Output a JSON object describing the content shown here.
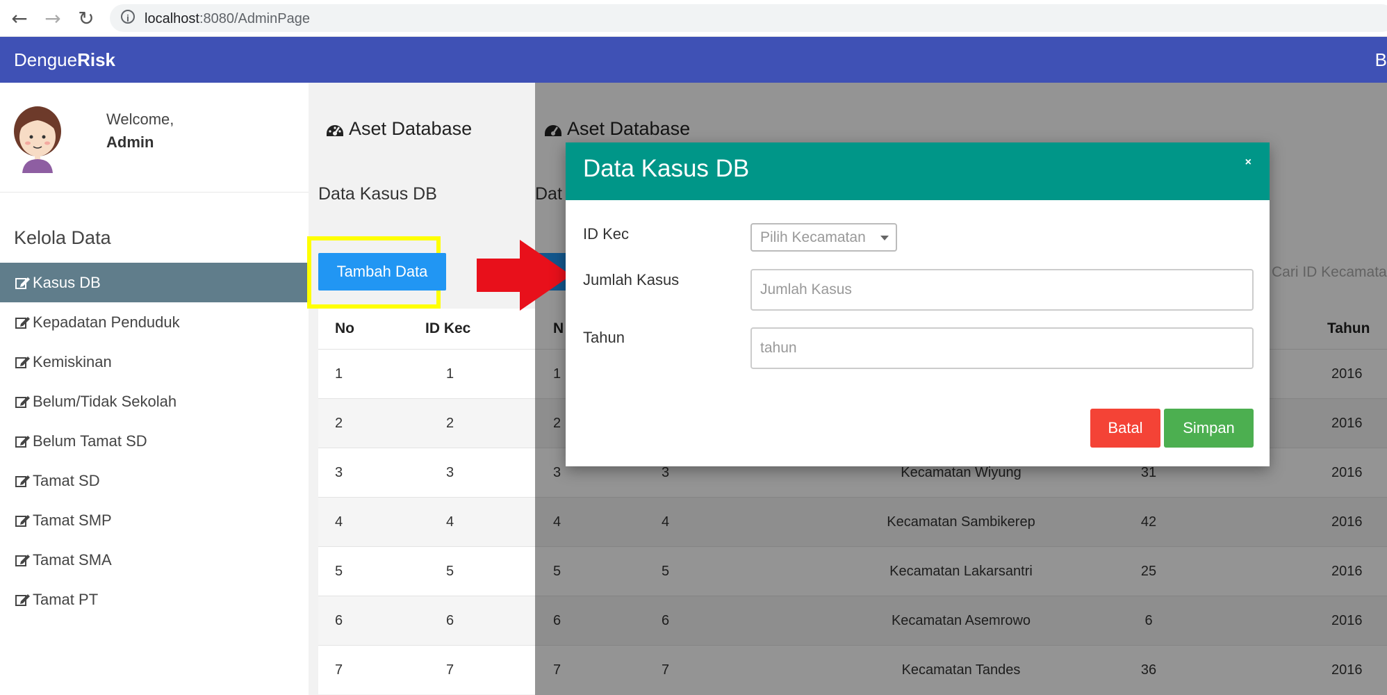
{
  "browser": {
    "url_host": "localhost",
    "url_path": ":8080/AdminPage",
    "back_icon": "←",
    "forward_icon": "→",
    "reload_icon": "↻",
    "info_icon": "i"
  },
  "navbar": {
    "brand_a": "Dengue",
    "brand_b": "Risk",
    "right_text": "B"
  },
  "sidebar": {
    "welcome": "Welcome,",
    "user": "Admin",
    "section": "Kelola Data",
    "items": [
      {
        "label": "Kasus DB",
        "active": true
      },
      {
        "label": "Kepadatan Penduduk"
      },
      {
        "label": "Kemiskinan"
      },
      {
        "label": "Belum/Tidak Sekolah"
      },
      {
        "label": "Belum Tamat SD"
      },
      {
        "label": "Tamat SD"
      },
      {
        "label": "Tamat SMP"
      },
      {
        "label": "Tamat SMA"
      },
      {
        "label": "Tamat PT"
      }
    ]
  },
  "main": {
    "title": "Aset Database",
    "subtitle": "Data Kasus DB",
    "subtitle_partial": "Dat",
    "add_button": "Tambah Data",
    "search_placeholder": "Cari ID Kecamatan"
  },
  "table": {
    "headers": {
      "no": "No",
      "id": "ID Kec",
      "no_dim": "N",
      "tahun": "Tahun"
    },
    "rows": [
      {
        "no": "1",
        "id": "1",
        "kec": "",
        "kasus": "",
        "tahun": "2016"
      },
      {
        "no": "2",
        "id": "2",
        "kec": "",
        "kasus": "",
        "tahun": "2016"
      },
      {
        "no": "3",
        "id": "3",
        "kec": "Kecamatan Wiyung",
        "kasus": "31",
        "tahun": "2016"
      },
      {
        "no": "4",
        "id": "4",
        "kec": "Kecamatan Sambikerep",
        "kasus": "42",
        "tahun": "2016"
      },
      {
        "no": "5",
        "id": "5",
        "kec": "Kecamatan Lakarsantri",
        "kasus": "25",
        "tahun": "2016"
      },
      {
        "no": "6",
        "id": "6",
        "kec": "Kecamatan Asemrowo",
        "kasus": "6",
        "tahun": "2016"
      },
      {
        "no": "7",
        "id": "7",
        "kec": "Kecamatan Tandes",
        "kasus": "36",
        "tahun": "2016"
      }
    ]
  },
  "modal": {
    "title": "Data Kasus DB",
    "close": "×",
    "label_idkec": "ID Kec",
    "select_placeholder": "Pilih Kecamatan",
    "label_jumlah": "Jumlah Kasus",
    "placeholder_jumlah": "Jumlah Kasus",
    "label_tahun": "Tahun",
    "placeholder_tahun": "tahun",
    "batal": "Batal",
    "simpan": "Simpan"
  },
  "colors": {
    "navbar": "#3f51b5",
    "active_menu": "#607d8b",
    "modal_header": "#009688",
    "primary": "#2196f3",
    "danger": "#f44336",
    "success": "#4caf50",
    "highlight": "#ffff00",
    "arrow": "#e8101b"
  },
  "icons": {
    "title_icon": "dashboard-icon",
    "menu_icon": "edit-icon"
  }
}
